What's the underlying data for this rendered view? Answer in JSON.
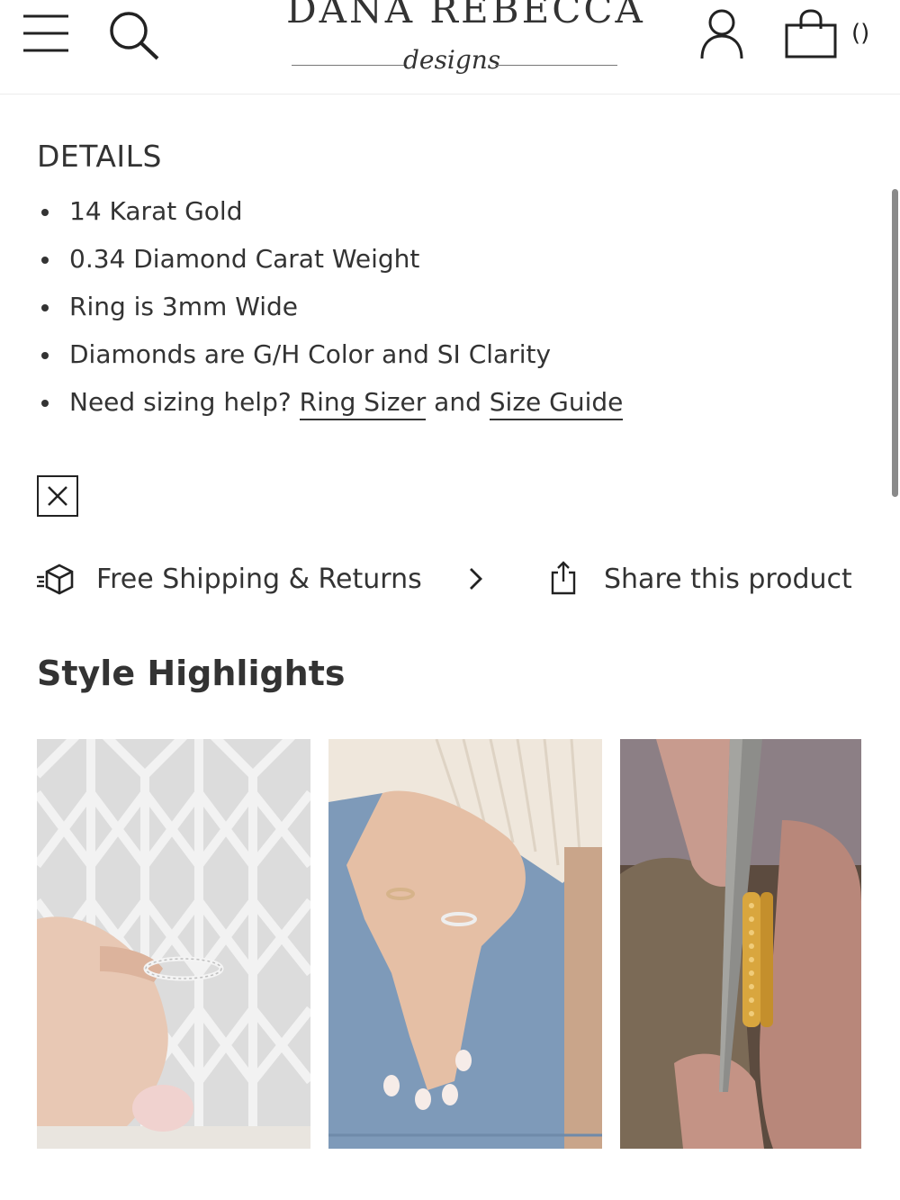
{
  "header": {
    "logo_main": "DANA REBECCA",
    "logo_sub": "designs",
    "cart_count": "()",
    "icons": [
      "menu-icon",
      "search-icon",
      "account-icon",
      "shopping-bag-icon"
    ]
  },
  "details": {
    "title": "DETAILS",
    "items": [
      "14 Karat Gold",
      "0.34 Diamond Carat Weight",
      "Ring is 3mm Wide",
      "Diamonds are G/H Color and SI Clarity"
    ],
    "sizing": {
      "prefix": "Need sizing help? ",
      "ring_sizer_link": "Ring Sizer",
      "joiner": " and ",
      "size_guide_link": "Size Guide"
    }
  },
  "actions": {
    "shipping_label": "Free Shipping & Returns",
    "share_label": "Share this product"
  },
  "style_highlights": {
    "title": "Style Highlights"
  },
  "colors": {
    "text": "#333333",
    "background": "#ffffff"
  }
}
